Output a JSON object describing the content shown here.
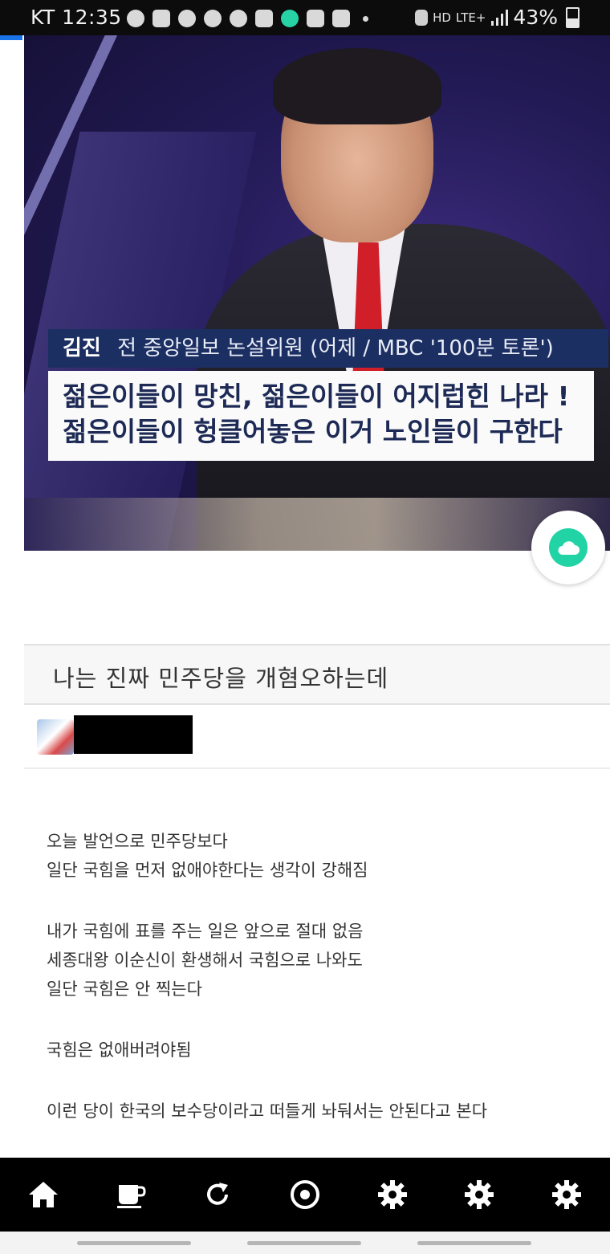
{
  "status_bar": {
    "carrier_time": "KT 12:35",
    "network_hd": "HD",
    "network_type": "LTE+",
    "battery": "43%",
    "battery_level": 0.43,
    "notification_icons": [
      "whatsapp-icon",
      "chat-bubble-icon",
      "leaf-icon",
      "face-icon",
      "c-icon",
      "newspaper-icon",
      "cloud-icon",
      "youtube-icon",
      "youtube-icon",
      "dot-icon"
    ]
  },
  "hero": {
    "caption_name": "김진",
    "caption_role": "전 중앙일보 논설위원 (어제 / MBC '100분 토론')",
    "caption_line1": "젊은이들이 망친, 젊은이들이 어지럽힌 나라 !",
    "caption_line2": "젊은이들이 헝클어놓은 이거 노인들이 구한다"
  },
  "post": {
    "title": "나는 진짜 민주당을 개혐오하는데",
    "body": [
      [
        "오늘 발언으로 민주당보다",
        "일단 국힘을 먼저 없애야한다는 생각이 강해짐"
      ],
      [
        "내가 국힘에 표를 주는 일은 앞으로 절대 없음",
        "세종대왕 이순신이 환생해서 국힘으로 나와도",
        "일단 국힘은 안 찍는다"
      ],
      [
        "국힘은 없애버려야됨"
      ],
      [
        "이런 당이 한국의 보수당이라고 떠들게 놔둬서는 안된다고 본다"
      ]
    ]
  },
  "toolbar": {
    "buttons": [
      "home-icon",
      "coffee-cup-icon",
      "refresh-icon",
      "target-icon",
      "gear-icon",
      "gear-icon",
      "gear-icon"
    ]
  },
  "colors": {
    "accent_green": "#22d3a6",
    "caption_navy": "#1c2f62",
    "progress_blue": "#1a73e8"
  }
}
